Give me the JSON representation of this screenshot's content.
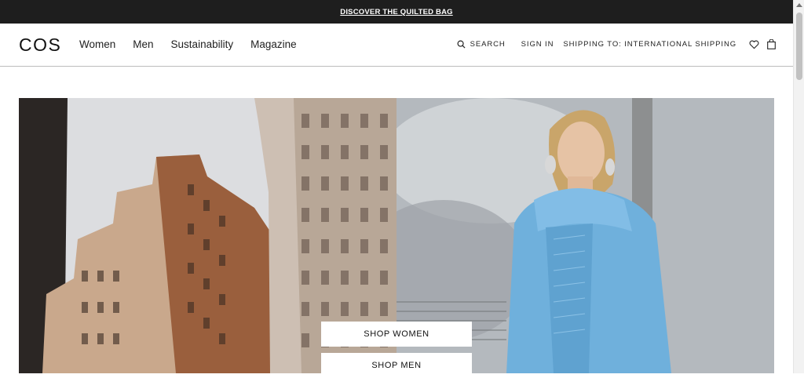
{
  "announcement": {
    "link_label": "DISCOVER THE QUILTED BAG"
  },
  "header": {
    "logo": "COS",
    "nav": [
      {
        "label": "Women"
      },
      {
        "label": "Men"
      },
      {
        "label": "Sustainability"
      },
      {
        "label": "Magazine"
      }
    ],
    "utility": {
      "search_label": "SEARCH",
      "signin_label": "SIGN IN",
      "shipping_label": "SHIPPING TO: INTERNATIONAL SHIPPING",
      "wishlist_icon": "heart-icon",
      "bag_icon": "bag-icon"
    }
  },
  "hero": {
    "cta_women": "SHOP WOMEN",
    "cta_men": "SHOP MEN"
  },
  "colors": {
    "announcement_bg": "#1e1e1e",
    "text": "#111111",
    "sweater_blue": "#6fb0dc",
    "building_brown": "#8a5a3f"
  }
}
